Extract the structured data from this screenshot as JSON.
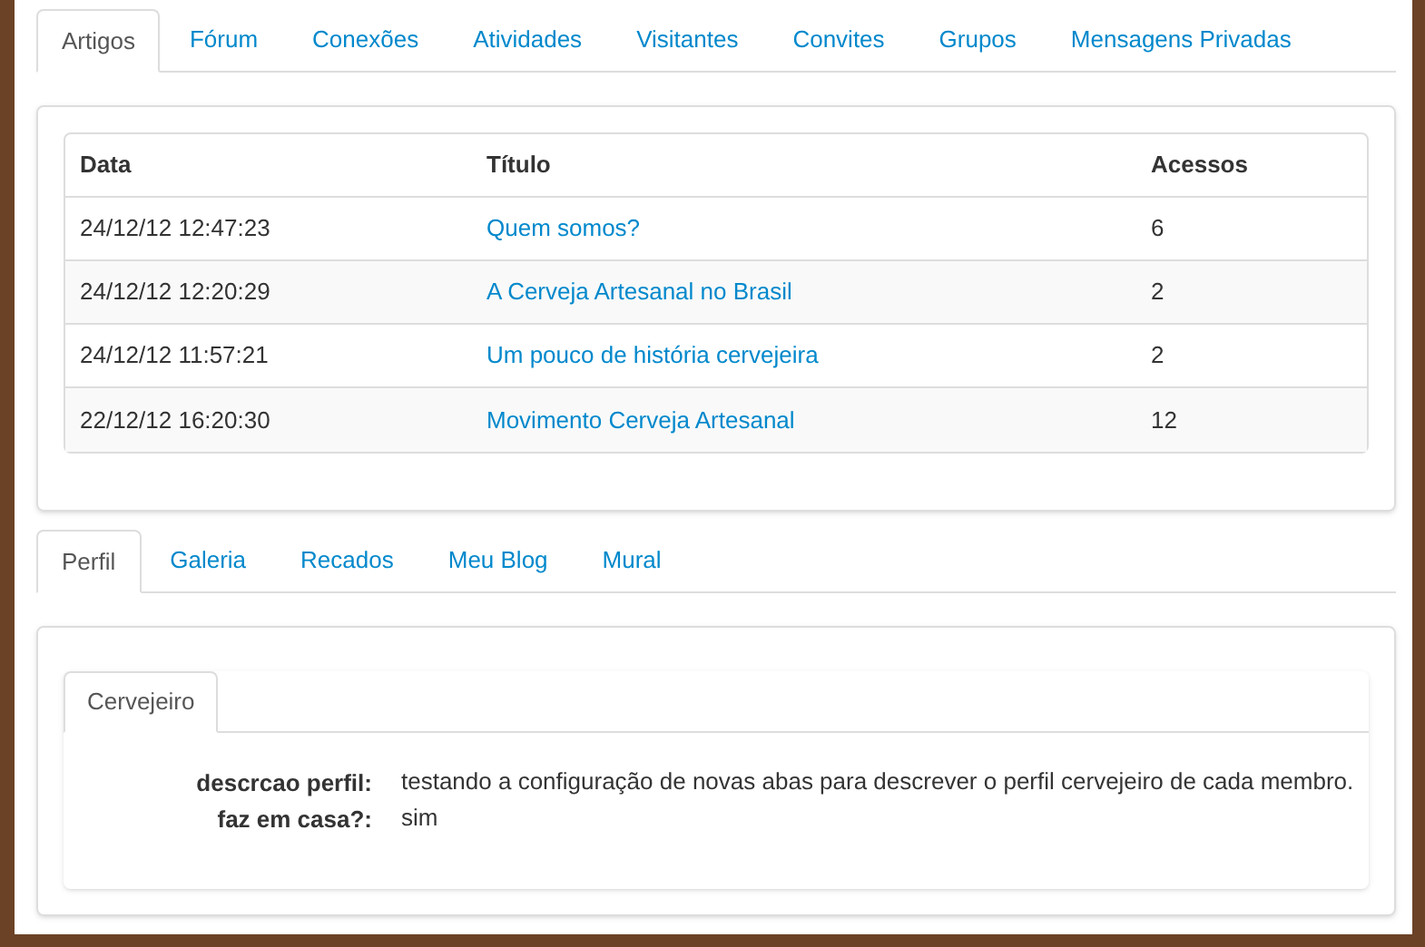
{
  "main_tabs": [
    {
      "label": "Artigos",
      "selected": true
    },
    {
      "label": "Fórum",
      "selected": false
    },
    {
      "label": "Conexões",
      "selected": false
    },
    {
      "label": "Atividades",
      "selected": false
    },
    {
      "label": "Visitantes",
      "selected": false
    },
    {
      "label": "Convites",
      "selected": false
    },
    {
      "label": "Grupos",
      "selected": false
    },
    {
      "label": "Mensagens Privadas",
      "selected": false
    }
  ],
  "articles_table": {
    "columns": [
      "Data",
      "Título",
      "Acessos"
    ],
    "rows": [
      {
        "date": "24/12/12 12:47:23",
        "title": "Quem somos?",
        "views": "6"
      },
      {
        "date": "24/12/12 12:20:29",
        "title": "A Cerveja Artesanal no Brasil",
        "views": "2"
      },
      {
        "date": "24/12/12 11:57:21",
        "title": "Um pouco de história cervejeira",
        "views": "2"
      },
      {
        "date": "22/12/12 16:20:30",
        "title": "Movimento Cerveja Artesanal",
        "views": "12"
      }
    ]
  },
  "profile_tabs": [
    {
      "label": "Perfil",
      "selected": true
    },
    {
      "label": "Galeria",
      "selected": false
    },
    {
      "label": "Recados",
      "selected": false
    },
    {
      "label": "Meu Blog",
      "selected": false
    },
    {
      "label": "Mural",
      "selected": false
    }
  ],
  "profile_subtabs": [
    {
      "label": "Cervejeiro",
      "selected": true
    }
  ],
  "profile_fields": [
    {
      "label": "descrcao perfil:",
      "value": "testando a configuração de novas abas para descrever o perfil cervejeiro de cada membro."
    },
    {
      "label": "faz em casa?:",
      "value": "sim"
    }
  ]
}
